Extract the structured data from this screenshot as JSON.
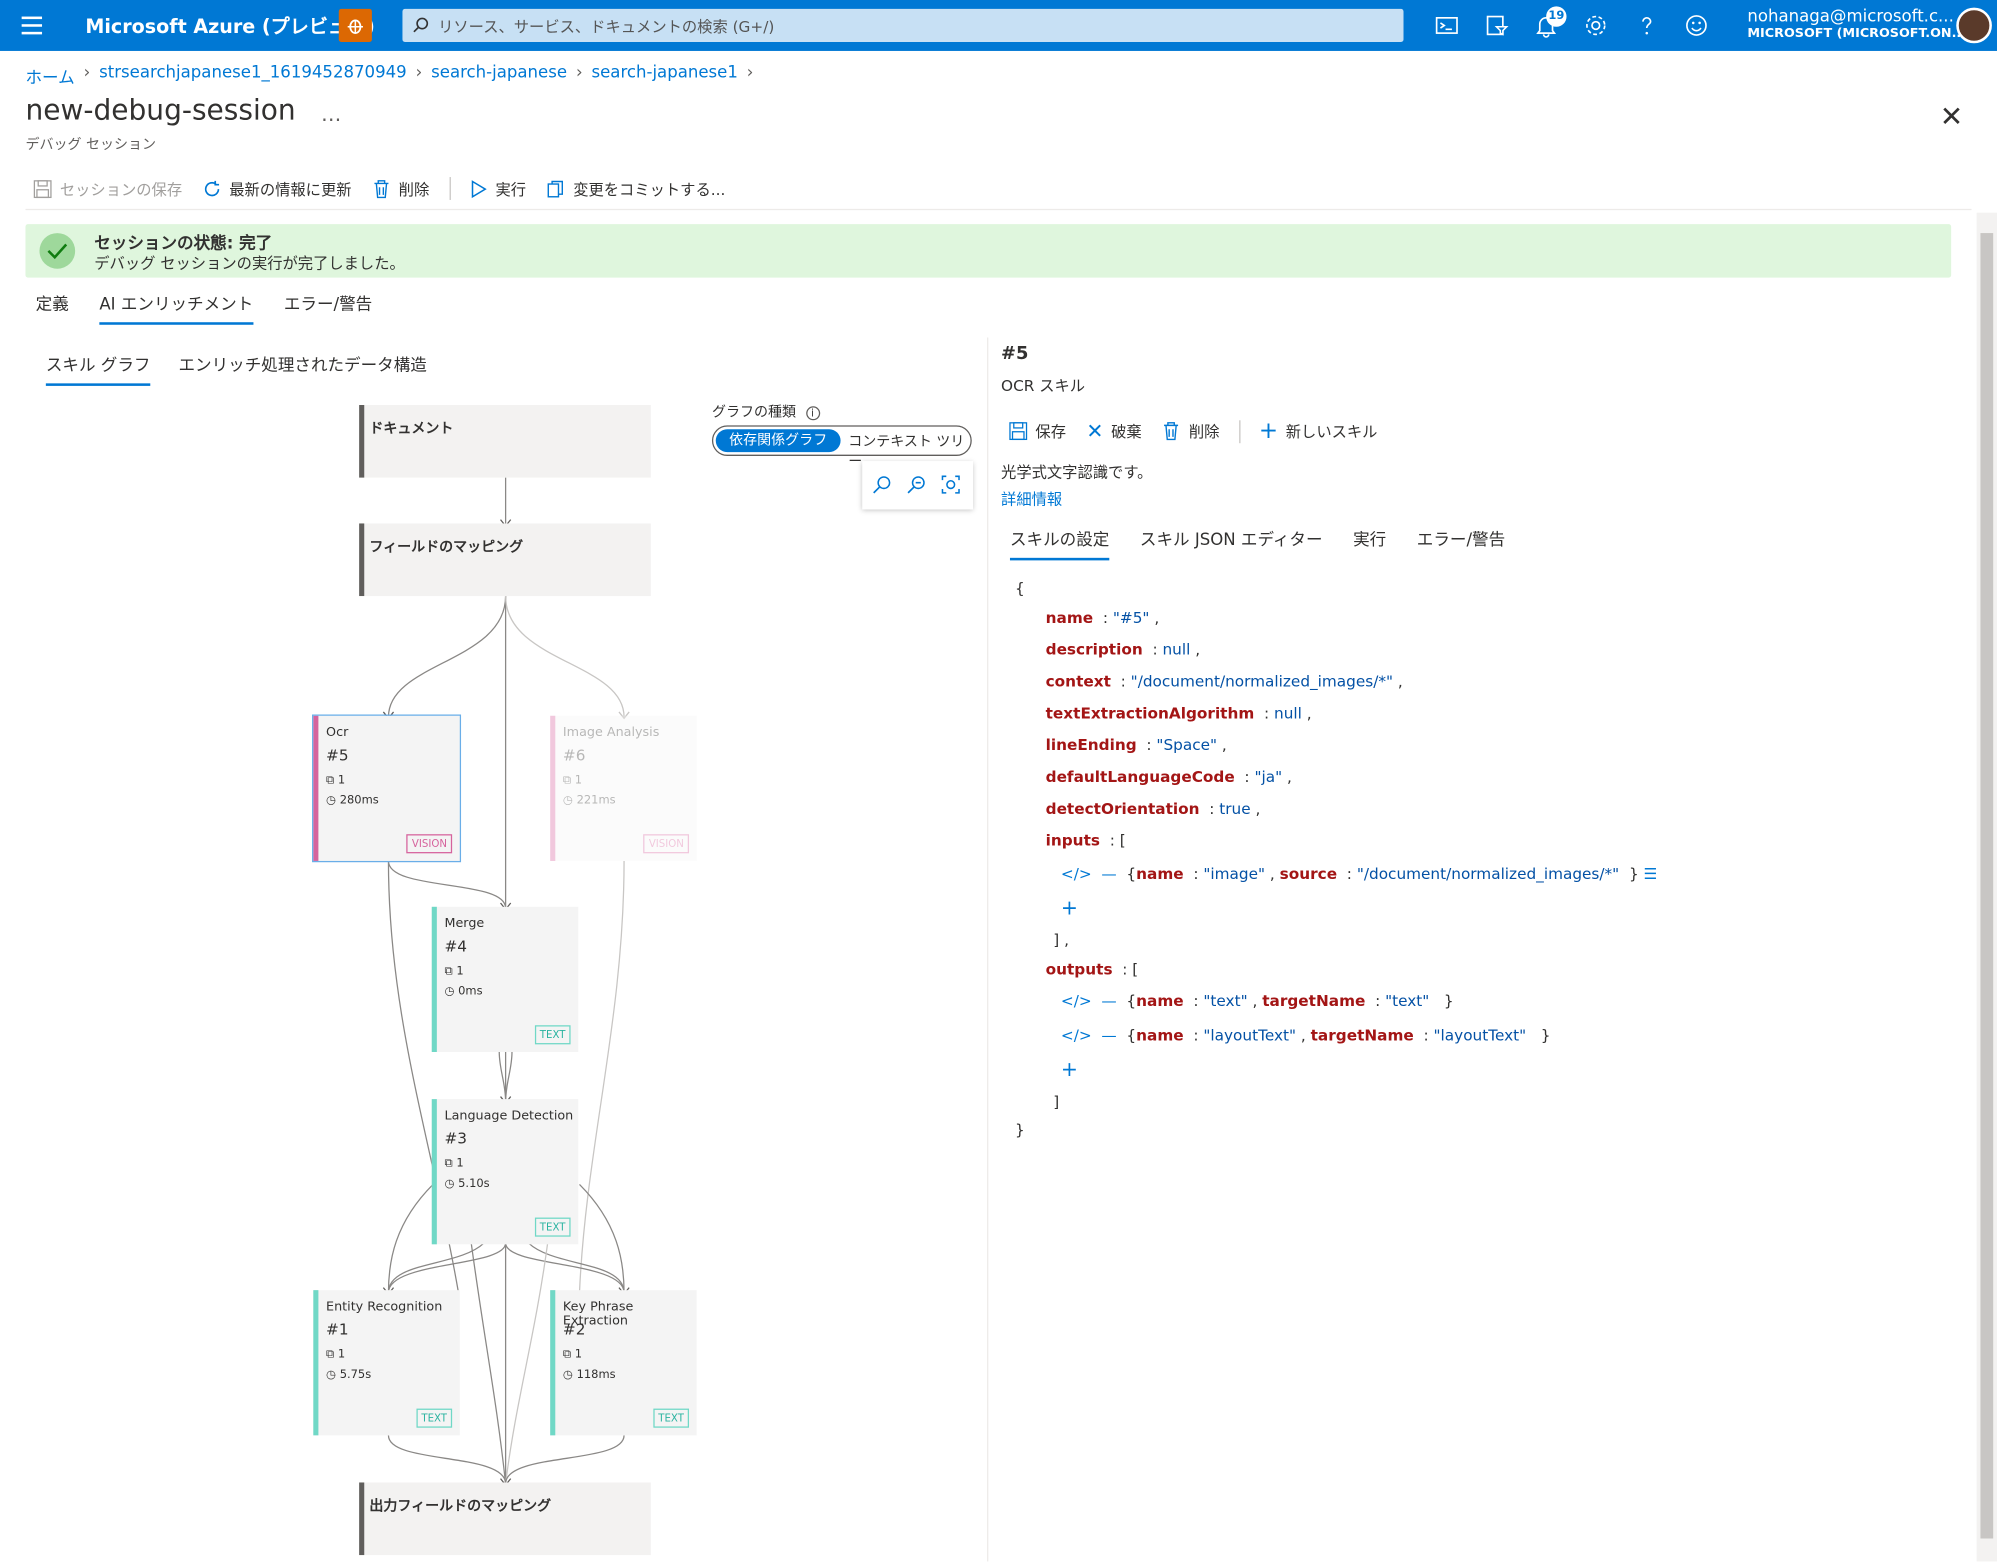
{
  "topbar": {
    "brand": "Microsoft Azure (プレビュー)",
    "search_placeholder": "リソース、サービス、ドキュメントの検索 (G+/)",
    "notification_count": "19",
    "user_name": "nohanaga@microsoft.c...",
    "user_org": "MICROSOFT (MICROSOFT.ON..."
  },
  "breadcrumb": [
    "ホーム",
    "strsearchjapanese1_1619452870949",
    "search-japanese",
    "search-japanese1"
  ],
  "page": {
    "title": "new-debug-session",
    "more": "…",
    "subtitle": "デバッグ セッション"
  },
  "toolbar": {
    "save": "セッションの保存",
    "refresh": "最新の情報に更新",
    "delete": "削除",
    "run": "実行",
    "commit": "変更をコミットする..."
  },
  "status": {
    "title": "セッションの状態: 完了",
    "message": "デバッグ セッションの実行が完了しました。"
  },
  "tabs": [
    "定義",
    "AI エンリッチメント",
    "エラー/警告"
  ],
  "subtabs": [
    "スキル グラフ",
    "エンリッチ処理されたデータ構造"
  ],
  "graph": {
    "type_label": "グラフの種類",
    "toggle_on": "依存関係グラフ",
    "toggle_off": "コンテキスト ツリー",
    "document": "ドキュメント",
    "field_mapping": "フィールドのマッピング",
    "output_mapping": "出力フィールドのマッピング",
    "skills": [
      {
        "type": "Ocr",
        "num": "#5",
        "count": "1",
        "time": "280ms",
        "tag": "VISION"
      },
      {
        "type": "Image Analysis",
        "num": "#6",
        "count": "1",
        "time": "221ms",
        "tag": "VISION"
      },
      {
        "type": "Merge",
        "num": "#4",
        "count": "1",
        "time": "0ms",
        "tag": "TEXT"
      },
      {
        "type": "Language Detection",
        "num": "#3",
        "count": "1",
        "time": "5.10s",
        "tag": "TEXT"
      },
      {
        "type": "Entity Recognition",
        "num": "#1",
        "count": "1",
        "time": "5.75s",
        "tag": "TEXT"
      },
      {
        "type": "Key Phrase Extraction",
        "num": "#2",
        "count": "1",
        "time": "118ms",
        "tag": "TEXT"
      }
    ]
  },
  "detail": {
    "num": "#5",
    "name": "OCR スキル",
    "tools": {
      "save": "保存",
      "discard": "破棄",
      "delete": "削除",
      "new_skill": "新しいスキル"
    },
    "description": "光学式文字認識です。",
    "more_info": "詳細情報",
    "tabs": [
      "スキルの設定",
      "スキル JSON エディター",
      "実行",
      "エラー/警告"
    ],
    "json": {
      "name": "\"#5\"",
      "description": "null",
      "context": "\"/document/normalized_images/*\"",
      "textExtractionAlgorithm": "null",
      "lineEnding": "\"Space\"",
      "defaultLanguageCode": "\"ja\"",
      "detectOrientation": "true",
      "input1": {
        "name": "\"image\"",
        "source": "\"/document/normalized_images/*\""
      },
      "output1": {
        "name": "\"text\"",
        "targetName": "\"text\""
      },
      "output2": {
        "name": "\"layoutText\"",
        "targetName": "\"layoutText\""
      }
    }
  },
  "colors": {
    "accent": "#0078d4",
    "success_bg": "#dff6dd",
    "vision": "#d6639d",
    "text": "#70d8c6"
  }
}
